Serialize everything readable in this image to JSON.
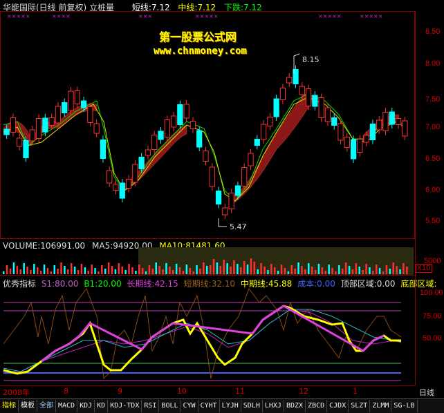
{
  "header": {
    "title": "华能国际(日线 前复权) 立桩量",
    "short_label": "短线:7.12",
    "mid_label": "中线:7.12",
    "fall_label": "下跌:7.12"
  },
  "watermark": {
    "line1": "第一股票公式网",
    "line2": "www.chnmoney.com"
  },
  "price_panel": {
    "y_labels": [
      "8.50",
      "8.00",
      "7.50",
      "7.00",
      "6.50",
      "6.00",
      "5.50"
    ],
    "high_annotation": "8.15",
    "low_annotation": "5.47"
  },
  "volume_panel": {
    "volume_label": "VOLUME:106991.00",
    "ma5_label": "MA5:94920.00",
    "ma10_label": "MA10:81481.60",
    "y_label": "5000",
    "x10_label": "X10"
  },
  "indicator_panel": {
    "name": "优秀指标",
    "s1": "S1:80.00",
    "b1": "B1:20.00",
    "long_line": "长期线:42.15",
    "short_line": "短期线:32.10",
    "mid_line": "中期线:45.88",
    "cost": "成本:0.00",
    "top_zone": "顶部区域:0.00",
    "bottom_zone": "底部区域:",
    "y_labels": [
      "100.00",
      "75.00",
      "50.00"
    ]
  },
  "x_axis": {
    "labels": [
      "2008年",
      "8",
      "9",
      "10",
      "11",
      "12",
      "1"
    ],
    "period": "日线"
  },
  "tabs": [
    "指标",
    "模板",
    "全部",
    "MACD",
    "KDJ",
    "KD",
    "KDJ-TDX",
    "RSI",
    "BOLL",
    "CYW",
    "CYHT",
    "LYJH",
    "SDLH",
    "LHXJ",
    "BDZX",
    "ZBCD",
    "CJDX",
    "SLZT",
    "ZLMM",
    "SG-LB"
  ],
  "colors": {
    "up": "#ff3030",
    "down": "#00ffff",
    "short_line": "#ffff00",
    "mid_line": "#00ff00",
    "fall_line": "#ffffff",
    "axis": "#cc0000"
  }
}
